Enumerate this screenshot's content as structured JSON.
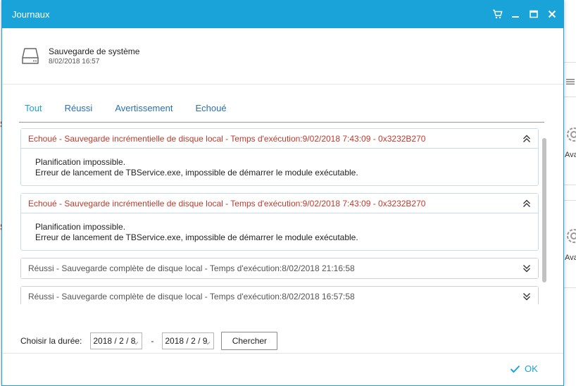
{
  "window": {
    "title": "Journaux"
  },
  "job": {
    "name": "Sauvegarde de système",
    "date": "8/02/2018 16:57"
  },
  "tabs": [
    {
      "label": "Tout",
      "active": true
    },
    {
      "label": "Réussi",
      "active": false
    },
    {
      "label": "Avertissement",
      "active": false
    },
    {
      "label": "Echoué",
      "active": false
    }
  ],
  "logs": [
    {
      "title": "Echoué - Sauvegarde incrémentielle de disque local - Temps d'exécution:9/02/2018 7:43:09 - 0x3232B270",
      "status": "fail",
      "expanded": true,
      "lines": [
        "Planification impossible.",
        "Erreur de lancement de TBService.exe, impossible de démarrer le module exécutable."
      ]
    },
    {
      "title": "Echoué - Sauvegarde incrémentielle de disque local - Temps d'exécution:9/02/2018 7:43:09 - 0x3232B270",
      "status": "fail",
      "expanded": true,
      "lines": [
        "Planification impossible.",
        "Erreur de lancement de TBService.exe, impossible de démarrer le module exécutable."
      ]
    },
    {
      "title": "Réussi - Sauvegarde complète de disque local - Temps d'exécution:8/02/2018 21:16:58",
      "status": "ok",
      "expanded": false,
      "lines": []
    },
    {
      "title": "Réussi - Sauvegarde complète de disque local - Temps d'exécution:8/02/2018 16:57:58",
      "status": "ok",
      "expanded": false,
      "lines": []
    }
  ],
  "filter": {
    "label": "Choisir la durée:",
    "from": "2018 / 2 / 8",
    "separator": "-",
    "to": "2018 / 2 / 9",
    "search_label": "Chercher"
  },
  "footer": {
    "ok_label": "OK"
  },
  "background": {
    "side_label_1": "Avar",
    "side_label_2": "Avar",
    "red_mark_1": "S",
    "red_mark_2": "S"
  },
  "colors": {
    "accent": "#1aa3d9",
    "fail": "#c0392b",
    "tab_link": "#2a6fb5"
  },
  "icons": {
    "cart": "cart-icon",
    "minimize": "minimize-icon",
    "maximize": "maximize-icon",
    "close": "close-icon",
    "hdd": "hard-drive-icon",
    "collapse": "chevron-double-up-icon",
    "expand": "chevron-double-down-icon",
    "ok": "check-icon"
  }
}
